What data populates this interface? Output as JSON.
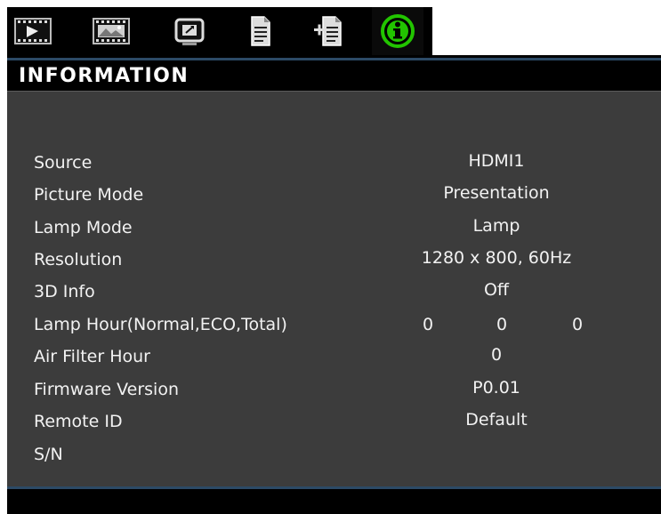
{
  "tabs": [
    {
      "icon": "image-adjust-icon"
    },
    {
      "icon": "picture-settings-icon"
    },
    {
      "icon": "display-icon"
    },
    {
      "icon": "settings-document-icon"
    },
    {
      "icon": "options-document-icon"
    },
    {
      "icon": "information-icon",
      "active": true
    }
  ],
  "header": {
    "title": "INFORMATION"
  },
  "rows": [
    {
      "label": "Source",
      "value": "HDMI1"
    },
    {
      "label": "Picture Mode",
      "value": "Presentation"
    },
    {
      "label": "Lamp Mode",
      "value": "Lamp"
    },
    {
      "label": "Resolution",
      "value": "1280 x 800, 60Hz"
    },
    {
      "label": "3D Info",
      "value": "Off"
    },
    {
      "label": "Lamp Hour(Normal,ECO,Total)",
      "values": [
        "0",
        "0",
        "0"
      ]
    },
    {
      "label": "Air Filter Hour",
      "value": "0"
    },
    {
      "label": "Firmware Version",
      "value": "P0.01"
    },
    {
      "label": "Remote ID",
      "value": "Default"
    },
    {
      "label": "S/N",
      "value": ""
    }
  ],
  "colors": {
    "accent": "#2c4a66",
    "active_icon": "#22c400",
    "panel": "#3c3c3c"
  }
}
